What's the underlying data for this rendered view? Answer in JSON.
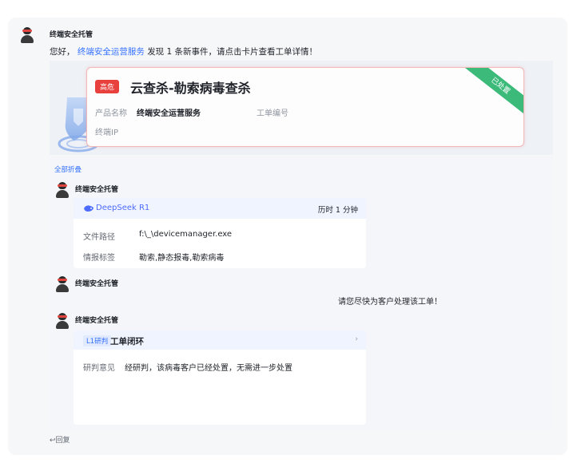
{
  "sender_name": "终端安全托管",
  "greeting": {
    "prefix": "您好，",
    "link": "终端安全运营服务",
    "suffix": "发现 1 条新事件，请点击卡片查看工单详情！"
  },
  "incident": {
    "severity": "高危",
    "title": "云查杀-勒索病毒查杀",
    "status": "已处置",
    "product_label": "产品名称",
    "product_value": "终端安全运营服务",
    "ticket_label": "工单编号",
    "ip_label": "终端IP"
  },
  "collapse_label": "全部折叠",
  "analysis_card": {
    "model": "DeepSeek R1",
    "time_label": "历时",
    "time_value": "1 分钟",
    "file_label": "文件路径",
    "file_value": "f:\\_\\devicemanager.exe",
    "tag_label": "情报标签",
    "tag_value": "勒索,静态报毒,勒索病毒"
  },
  "reminder": "请您尽快为客户处理该工单！",
  "closed_card": {
    "tag": "L1研判",
    "title": "工单闭环",
    "more": "›",
    "opinion_label": "研判意见",
    "opinion_value": "经研判，该病毒客户已经处置，无需进一步处置"
  },
  "reply_label": "↩回复",
  "colors": {
    "link": "#3370ff",
    "danger": "#e8403d",
    "resolved": "#3bba7a"
  }
}
